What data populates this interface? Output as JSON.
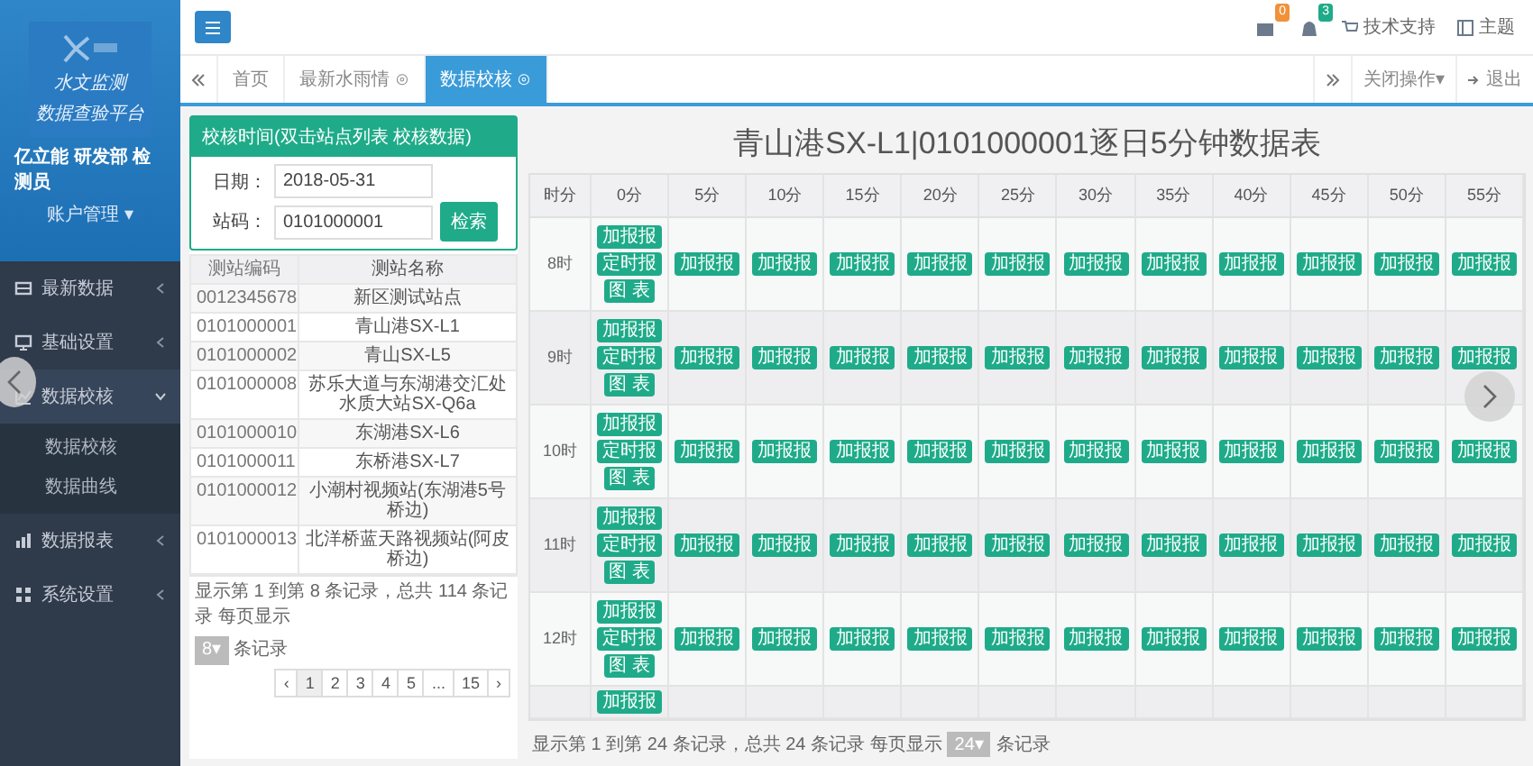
{
  "sidebar": {
    "logo_lines": [
      "水文监测",
      "数据查验平台"
    ],
    "user": "亿立能 研发部 检测员",
    "account": "账户管理 ▾",
    "items": [
      {
        "label": "最新数据",
        "expanded": false,
        "selected": false
      },
      {
        "label": "基础设置",
        "expanded": false,
        "selected": false
      },
      {
        "label": "数据校核",
        "expanded": true,
        "selected": true,
        "children": [
          {
            "label": "数据校核"
          },
          {
            "label": "数据曲线"
          }
        ]
      },
      {
        "label": "数据报表",
        "expanded": false,
        "selected": false
      },
      {
        "label": "系统设置",
        "expanded": false,
        "selected": false
      }
    ]
  },
  "topbar": {
    "badges": [
      {
        "count": "0",
        "color": "#f0923a"
      },
      {
        "count": "3",
        "color": "#1fab89"
      }
    ],
    "links": [
      "技术支持",
      "主题"
    ]
  },
  "tabs": [
    {
      "label": "首页",
      "selected": false
    },
    {
      "label": "最新水雨情 ⊙",
      "selected": false
    },
    {
      "label": "数据校核 ⊙",
      "selected": true
    }
  ],
  "tab_actions": {
    "close_menu": "关闭操作▾",
    "logout": "退出"
  },
  "query_panel": {
    "header": "校核时间(双击站点列表 校核数据)",
    "date_label": "日期：",
    "date": "2018-05-31",
    "station_label": "站码：",
    "station": "0101000001",
    "button": "检索",
    "columns": [
      "测站编码",
      "测站名称"
    ],
    "rows": [
      [
        "0012345678",
        "新区测试站点"
      ],
      [
        "0101000001",
        "青山港SX-L1"
      ],
      [
        "0101000002",
        "青山SX-L5"
      ],
      [
        "0101000008",
        "苏乐大道与东湖港交汇处水质大站SX-Q6a"
      ],
      [
        "0101000010",
        "东湖港SX-L6"
      ],
      [
        "0101000011",
        "东桥港SX-L7"
      ],
      [
        "0101000012",
        "小潮村视频站(东湖港5号桥边)"
      ],
      [
        "0101000013",
        "北洋桥蓝天路视频站(阿皮桥边)"
      ]
    ],
    "footer_before": "显示第 1 到第 8 条记录，总共 114 条记录 每页显示",
    "page_size": "8▾",
    "footer_after": "条记录",
    "pages": [
      {
        "label": "‹",
        "selected": false
      },
      {
        "label": "1",
        "selected": true
      },
      {
        "label": "2",
        "selected": false
      },
      {
        "label": "3",
        "selected": false
      },
      {
        "label": "4",
        "selected": false
      },
      {
        "label": "5",
        "selected": false
      },
      {
        "label": "...",
        "selected": false
      },
      {
        "label": "15",
        "selected": false
      },
      {
        "label": "›",
        "selected": false
      }
    ]
  },
  "grid": {
    "title": "青山港SX-L1|0101000001逐日5分钟数据表",
    "columns": [
      "时分",
      "0分",
      "5分",
      "10分",
      "15分",
      "20分",
      "25分",
      "30分",
      "35分",
      "40分",
      "45分",
      "50分",
      "55分"
    ],
    "rows": [
      {
        "cells": [
          {
            "text": "8时"
          },
          {
            "buttons": [
              "加报报",
              "定时报",
              "图 表"
            ]
          },
          {
            "buttons": [
              "加报报"
            ]
          },
          {
            "buttons": [
              "加报报"
            ]
          },
          {
            "buttons": [
              "加报报"
            ]
          },
          {
            "buttons": [
              "加报报"
            ]
          },
          {
            "buttons": [
              "加报报"
            ]
          },
          {
            "buttons": [
              "加报报"
            ]
          },
          {
            "buttons": [
              "加报报"
            ]
          },
          {
            "buttons": [
              "加报报"
            ]
          },
          {
            "buttons": [
              "加报报"
            ]
          },
          {
            "buttons": [
              "加报报"
            ]
          },
          {
            "buttons": [
              "加报报"
            ]
          }
        ]
      },
      {
        "cells": [
          {
            "text": "9时"
          },
          {
            "buttons": [
              "加报报",
              "定时报",
              "图 表"
            ]
          },
          {
            "buttons": [
              "加报报"
            ]
          },
          {
            "buttons": [
              "加报报"
            ]
          },
          {
            "buttons": [
              "加报报"
            ]
          },
          {
            "buttons": [
              "加报报"
            ]
          },
          {
            "buttons": [
              "加报报"
            ]
          },
          {
            "buttons": [
              "加报报"
            ]
          },
          {
            "buttons": [
              "加报报"
            ]
          },
          {
            "buttons": [
              "加报报"
            ]
          },
          {
            "buttons": [
              "加报报"
            ]
          },
          {
            "buttons": [
              "加报报"
            ]
          },
          {
            "buttons": [
              "加报报"
            ]
          }
        ]
      },
      {
        "cells": [
          {
            "text": "10时"
          },
          {
            "buttons": [
              "加报报",
              "定时报",
              "图 表"
            ]
          },
          {
            "buttons": [
              "加报报"
            ]
          },
          {
            "buttons": [
              "加报报"
            ]
          },
          {
            "buttons": [
              "加报报"
            ]
          },
          {
            "buttons": [
              "加报报"
            ]
          },
          {
            "buttons": [
              "加报报"
            ]
          },
          {
            "buttons": [
              "加报报"
            ]
          },
          {
            "buttons": [
              "加报报"
            ]
          },
          {
            "buttons": [
              "加报报"
            ]
          },
          {
            "buttons": [
              "加报报"
            ]
          },
          {
            "buttons": [
              "加报报"
            ]
          },
          {
            "buttons": [
              "加报报"
            ]
          }
        ]
      },
      {
        "cells": [
          {
            "text": "11时"
          },
          {
            "buttons": [
              "加报报",
              "定时报",
              "图 表"
            ]
          },
          {
            "buttons": [
              "加报报"
            ]
          },
          {
            "buttons": [
              "加报报"
            ]
          },
          {
            "buttons": [
              "加报报"
            ]
          },
          {
            "buttons": [
              "加报报"
            ]
          },
          {
            "buttons": [
              "加报报"
            ]
          },
          {
            "buttons": [
              "加报报"
            ]
          },
          {
            "buttons": [
              "加报报"
            ]
          },
          {
            "buttons": [
              "加报报"
            ]
          },
          {
            "buttons": [
              "加报报"
            ]
          },
          {
            "buttons": [
              "加报报"
            ]
          },
          {
            "buttons": [
              "加报报"
            ]
          }
        ]
      },
      {
        "cells": [
          {
            "text": "12时"
          },
          {
            "buttons": [
              "加报报",
              "定时报",
              "图 表"
            ]
          },
          {
            "buttons": [
              "加报报"
            ]
          },
          {
            "buttons": [
              "加报报"
            ]
          },
          {
            "buttons": [
              "加报报"
            ]
          },
          {
            "buttons": [
              "加报报"
            ]
          },
          {
            "buttons": [
              "加报报"
            ]
          },
          {
            "buttons": [
              "加报报"
            ]
          },
          {
            "buttons": [
              "加报报"
            ]
          },
          {
            "buttons": [
              "加报报"
            ]
          },
          {
            "buttons": [
              "加报报"
            ]
          },
          {
            "buttons": [
              "加报报"
            ]
          },
          {
            "buttons": [
              "加报报"
            ]
          }
        ]
      },
      {
        "cells": [
          {},
          {
            "buttons": [
              "加报报"
            ]
          },
          {},
          {},
          {},
          {},
          {},
          {},
          {},
          {},
          {},
          {},
          {}
        ]
      }
    ],
    "footer_before": "显示第 1 到第 24 条记录，总共 24 条记录 每页显示",
    "page_size": "24▾",
    "footer_after": "条记录"
  }
}
